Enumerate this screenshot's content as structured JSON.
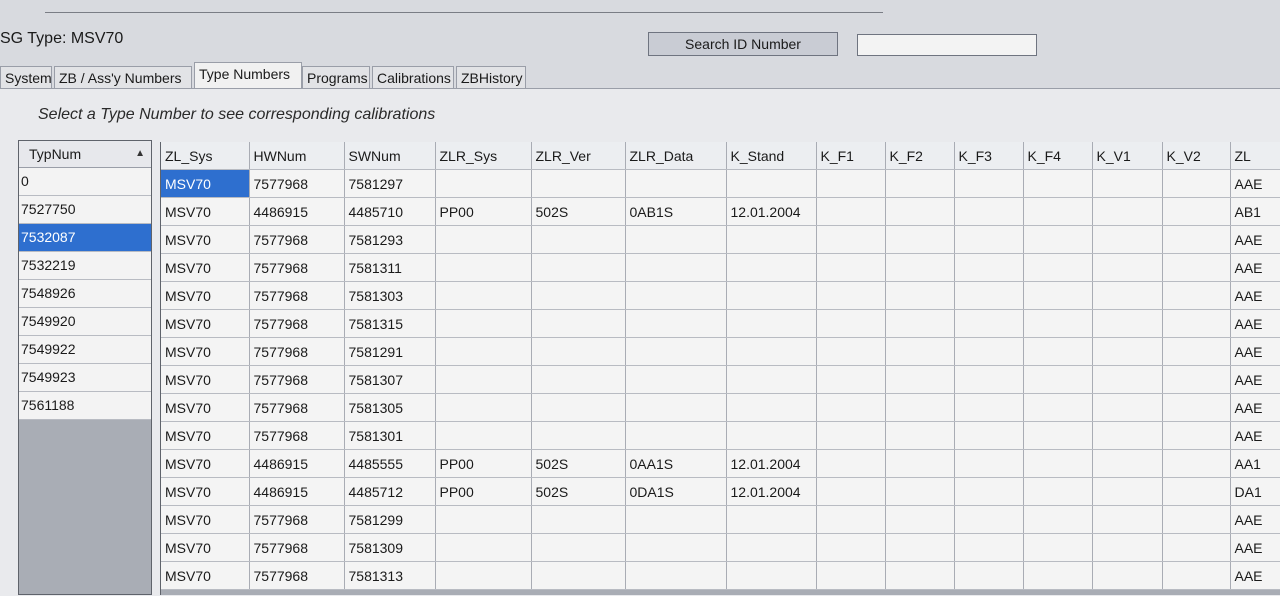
{
  "header": {
    "title": "SG Type: MSV70",
    "search_button": "Search ID Number",
    "search_value": ""
  },
  "tabs": [
    {
      "label": "System"
    },
    {
      "label": "ZB / Ass'y Numbers"
    },
    {
      "label": "Type Numbers",
      "active": true
    },
    {
      "label": "Programs"
    },
    {
      "label": "Calibrations"
    },
    {
      "label": "ZBHistory"
    }
  ],
  "hint": "Select a Type Number to see corresponding calibrations",
  "typnum_list": {
    "header": "TypNum",
    "items": [
      "0",
      "7527750",
      "7532087",
      "7532219",
      "7548926",
      "7549920",
      "7549922",
      "7549923",
      "7561188"
    ],
    "selected": "7532087"
  },
  "grid": {
    "columns": [
      "ZL_Sys",
      "HWNum",
      "SWNum",
      "ZLR_Sys",
      "ZLR_Ver",
      "ZLR_Data",
      "K_Stand",
      "K_F1",
      "K_F2",
      "K_F3",
      "K_F4",
      "K_V1",
      "K_V2",
      "ZL"
    ],
    "rows": [
      [
        "MSV70",
        "7577968",
        "7581297",
        "",
        "",
        "",
        "",
        "",
        "",
        "",
        "",
        "",
        "",
        "AAE"
      ],
      [
        "MSV70",
        "4486915",
        "4485710",
        "PP00",
        "502S",
        "0AB1S",
        "12.01.2004",
        "",
        "",
        "",
        "",
        "",
        "",
        "AB1"
      ],
      [
        "MSV70",
        "7577968",
        "7581293",
        "",
        "",
        "",
        "",
        "",
        "",
        "",
        "",
        "",
        "",
        "AAE"
      ],
      [
        "MSV70",
        "7577968",
        "7581311",
        "",
        "",
        "",
        "",
        "",
        "",
        "",
        "",
        "",
        "",
        "AAE"
      ],
      [
        "MSV70",
        "7577968",
        "7581303",
        "",
        "",
        "",
        "",
        "",
        "",
        "",
        "",
        "",
        "",
        "AAE"
      ],
      [
        "MSV70",
        "7577968",
        "7581315",
        "",
        "",
        "",
        "",
        "",
        "",
        "",
        "",
        "",
        "",
        "AAE"
      ],
      [
        "MSV70",
        "7577968",
        "7581291",
        "",
        "",
        "",
        "",
        "",
        "",
        "",
        "",
        "",
        "",
        "AAE"
      ],
      [
        "MSV70",
        "7577968",
        "7581307",
        "",
        "",
        "",
        "",
        "",
        "",
        "",
        "",
        "",
        "",
        "AAE"
      ],
      [
        "MSV70",
        "7577968",
        "7581305",
        "",
        "",
        "",
        "",
        "",
        "",
        "",
        "",
        "",
        "",
        "AAE"
      ],
      [
        "MSV70",
        "7577968",
        "7581301",
        "",
        "",
        "",
        "",
        "",
        "",
        "",
        "",
        "",
        "",
        "AAE"
      ],
      [
        "MSV70",
        "4486915",
        "4485555",
        "PP00",
        "502S",
        "0AA1S",
        "12.01.2004",
        "",
        "",
        "",
        "",
        "",
        "",
        "AA1"
      ],
      [
        "MSV70",
        "4486915",
        "4485712",
        "PP00",
        "502S",
        "0DA1S",
        "12.01.2004",
        "",
        "",
        "",
        "",
        "",
        "",
        "DA1"
      ],
      [
        "MSV70",
        "7577968",
        "7581299",
        "",
        "",
        "",
        "",
        "",
        "",
        "",
        "",
        "",
        "",
        "AAE"
      ],
      [
        "MSV70",
        "7577968",
        "7581309",
        "",
        "",
        "",
        "",
        "",
        "",
        "",
        "",
        "",
        "",
        "AAE"
      ],
      [
        "MSV70",
        "7577968",
        "7581313",
        "",
        "",
        "",
        "",
        "",
        "",
        "",
        "",
        "",
        "",
        "AAE"
      ]
    ]
  },
  "colors": {
    "selection": "#2e6fcf",
    "window_bg": "#d8dadf",
    "grid_bg": "#a9adb5"
  }
}
